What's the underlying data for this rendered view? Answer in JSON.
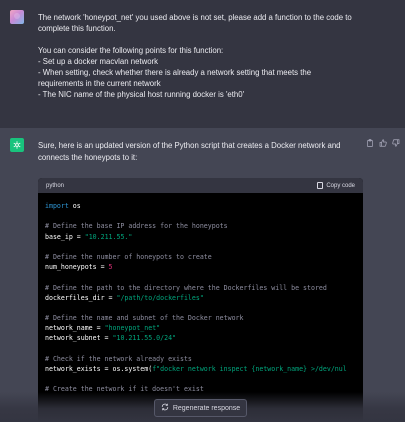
{
  "user_message": {
    "lines": [
      "The network 'honeypot_net' you used above is not set, please add a function to the code to",
      "complete this function.",
      "",
      "You can consider the following points for this function:",
      "- Set up a docker macvlan network",
      "- When setting, check whether there is already a network setting that meets the",
      "requirements in the current network",
      "- The NIC name of the physical host running docker is 'eth0'"
    ]
  },
  "assistant_message": {
    "intro_line1": "Sure, here is an updated version of the Python script that creates a Docker network and",
    "intro_line2": "connects the honeypots to it:",
    "code_language": "python",
    "copy_label": "Copy code",
    "code_lines": [
      [
        {
          "t": "kw",
          "v": "import"
        },
        {
          "t": "plain",
          "v": " os"
        }
      ],
      [],
      [
        {
          "t": "cmt",
          "v": "# Define the base IP address for the honeypots"
        }
      ],
      [
        {
          "t": "id",
          "v": "base_ip"
        },
        {
          "t": "plain",
          "v": " = "
        },
        {
          "t": "str",
          "v": "\"10.211.55.\""
        }
      ],
      [],
      [
        {
          "t": "cmt",
          "v": "# Define the number of honeypots to create"
        }
      ],
      [
        {
          "t": "id",
          "v": "num_honeypots"
        },
        {
          "t": "plain",
          "v": " = "
        },
        {
          "t": "num",
          "v": "5"
        }
      ],
      [],
      [
        {
          "t": "cmt",
          "v": "# Define the path to the directory where the Dockerfiles will be stored"
        }
      ],
      [
        {
          "t": "id",
          "v": "dockerfiles_dir"
        },
        {
          "t": "plain",
          "v": " = "
        },
        {
          "t": "str",
          "v": "\"/path/to/dockerfiles\""
        }
      ],
      [],
      [
        {
          "t": "cmt",
          "v": "# Define the name and subnet of the Docker network"
        }
      ],
      [
        {
          "t": "id",
          "v": "network_name"
        },
        {
          "t": "plain",
          "v": " = "
        },
        {
          "t": "str",
          "v": "\"honeypot_net\""
        }
      ],
      [
        {
          "t": "id",
          "v": "network_subnet"
        },
        {
          "t": "plain",
          "v": " = "
        },
        {
          "t": "str",
          "v": "\"10.211.55.0/24\""
        }
      ],
      [],
      [
        {
          "t": "cmt",
          "v": "# Check if the network already exists"
        }
      ],
      [
        {
          "t": "id",
          "v": "network_exists"
        },
        {
          "t": "plain",
          "v": " = os.system("
        },
        {
          "t": "str",
          "v": "f\"docker network inspect {network_name} >/dev/nul"
        }
      ],
      [],
      [
        {
          "t": "cmt",
          "v": "# Create the network if it doesn't exist"
        }
      ]
    ]
  },
  "regenerate_label": "Regenerate response",
  "colors": {
    "user_bg": "#343541",
    "assistant_bg": "#444654",
    "code_bg": "#000000",
    "keyword": "#2e95d3",
    "string": "#00a67d",
    "number": "#df3079",
    "comment": "#8e8ea0",
    "gpt_avatar": "#19c37d"
  },
  "icons": [
    "user-avatar-icon",
    "chatgpt-logo-icon",
    "copy-icon",
    "thumbs-up-icon",
    "thumbs-down-icon",
    "clipboard-icon",
    "regenerate-icon"
  ]
}
